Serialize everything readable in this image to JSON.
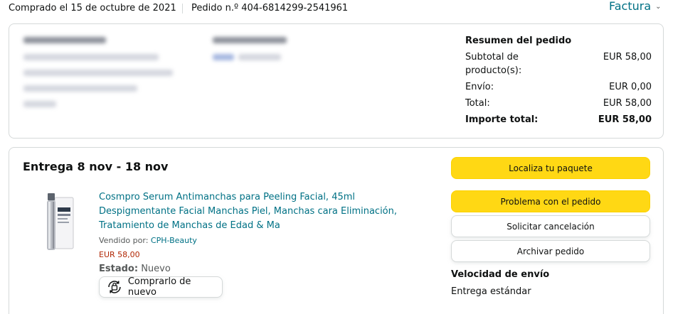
{
  "header": {
    "ordered_date": "Comprado el 15 de octubre de 2021",
    "order_number": "Pedido n.º 404-6814299-2541961",
    "invoice_label": "Factura",
    "invoice_chevron": "⌄"
  },
  "summary": {
    "title": "Resumen del pedido",
    "rows": [
      {
        "label": "Subtotal de producto(s):",
        "value": "EUR 58,00"
      },
      {
        "label": "Envío:",
        "value": "EUR 0,00"
      },
      {
        "label": "Total:",
        "value": "EUR 58,00"
      },
      {
        "label": "Importe total:",
        "value": "EUR 58,00"
      }
    ]
  },
  "delivery": {
    "title": "Entrega 8 nov - 18 nov",
    "product_title": "Cosmpro Serum Antimanchas para Peeling Facial, 45ml Despigmentante Facial Manchas Piel, Manchas cara Eliminación, Tratamiento de Manchas de Edad & Ma",
    "sold_by_label": "Vendido por:",
    "seller": "CPH-Beauty",
    "price": "EUR 58,00",
    "condition_label": "Estado:",
    "condition_value": "Nuevo",
    "rebuy_label": "Comprarlo de nuevo",
    "rebuy_icon": "buy-again-icon"
  },
  "actions": {
    "track": "Localiza tu paquete",
    "problem": "Problema con el pedido",
    "cancel": "Solicitar cancelación",
    "archive": "Archivar pedido"
  },
  "shipping": {
    "speed_label": "Velocidad de envío",
    "speed_value": "Entrega estándar"
  },
  "colors": {
    "link": "#007185",
    "price": "#b12704",
    "button_yellow": "#ffd814",
    "border": "#d5d9d9"
  }
}
